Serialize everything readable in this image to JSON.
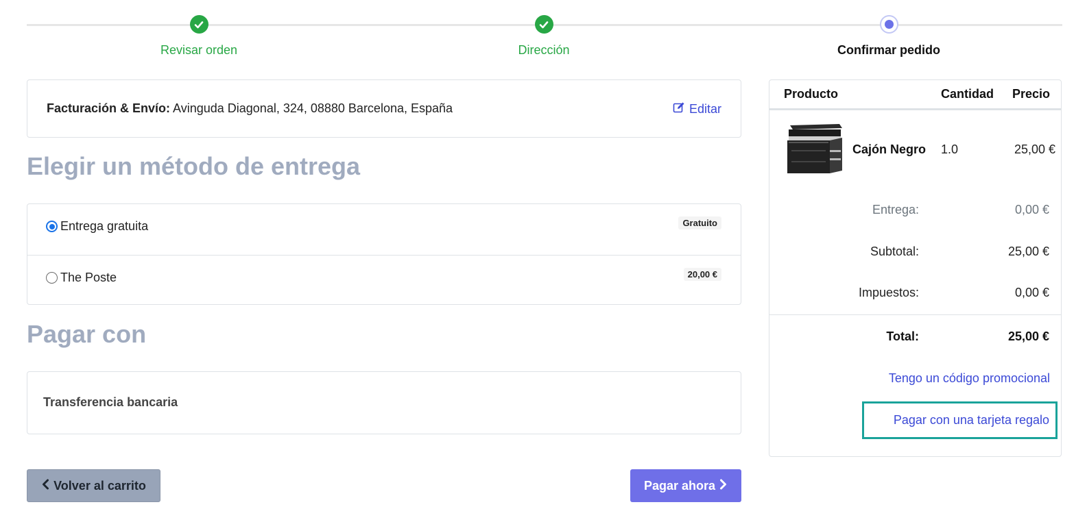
{
  "steps": [
    {
      "label": "Revisar orden",
      "state": "done"
    },
    {
      "label": "Dirección",
      "state": "done"
    },
    {
      "label": "Confirmar pedido",
      "state": "current"
    }
  ],
  "billing": {
    "label": "Facturación & Envío:",
    "address": "Avinguda Diagonal, 324, 08880 Barcelona, España",
    "edit_label": "Editar"
  },
  "delivery": {
    "title": "Elegir un método de entrega",
    "options": [
      {
        "label": "Entrega gratuita",
        "price": "Gratuito",
        "selected": true
      },
      {
        "label": "The Poste",
        "price": "20,00 €",
        "selected": false
      }
    ]
  },
  "payment": {
    "title": "Pagar con",
    "method": "Transferencia bancaria"
  },
  "buttons": {
    "back_label": "Volver al carrito",
    "pay_label": "Pagar ahora"
  },
  "summary": {
    "headers": {
      "product": "Producto",
      "quantity": "Cantidad",
      "price": "Precio"
    },
    "item": {
      "name": "Cajón Negro",
      "quantity": "1.0",
      "price": "25,00 €"
    },
    "delivery_label": "Entrega:",
    "delivery_value": "0,00 €",
    "subtotal_label": "Subtotal:",
    "subtotal_value": "25,00 €",
    "taxes_label": "Impuestos:",
    "taxes_value": "0,00 €",
    "total_label": "Total:",
    "total_value": "25,00 €",
    "promo_link": "Tengo un código promocional",
    "gift_link": "Pagar con una tarjeta regalo"
  },
  "colors": {
    "step_done": "#28a745",
    "step_current": "#6c72e8",
    "link": "#3b49d6",
    "pay_button": "#6f6fe8",
    "back_button": "#98a4b8",
    "highlight": "#1aa39a"
  }
}
